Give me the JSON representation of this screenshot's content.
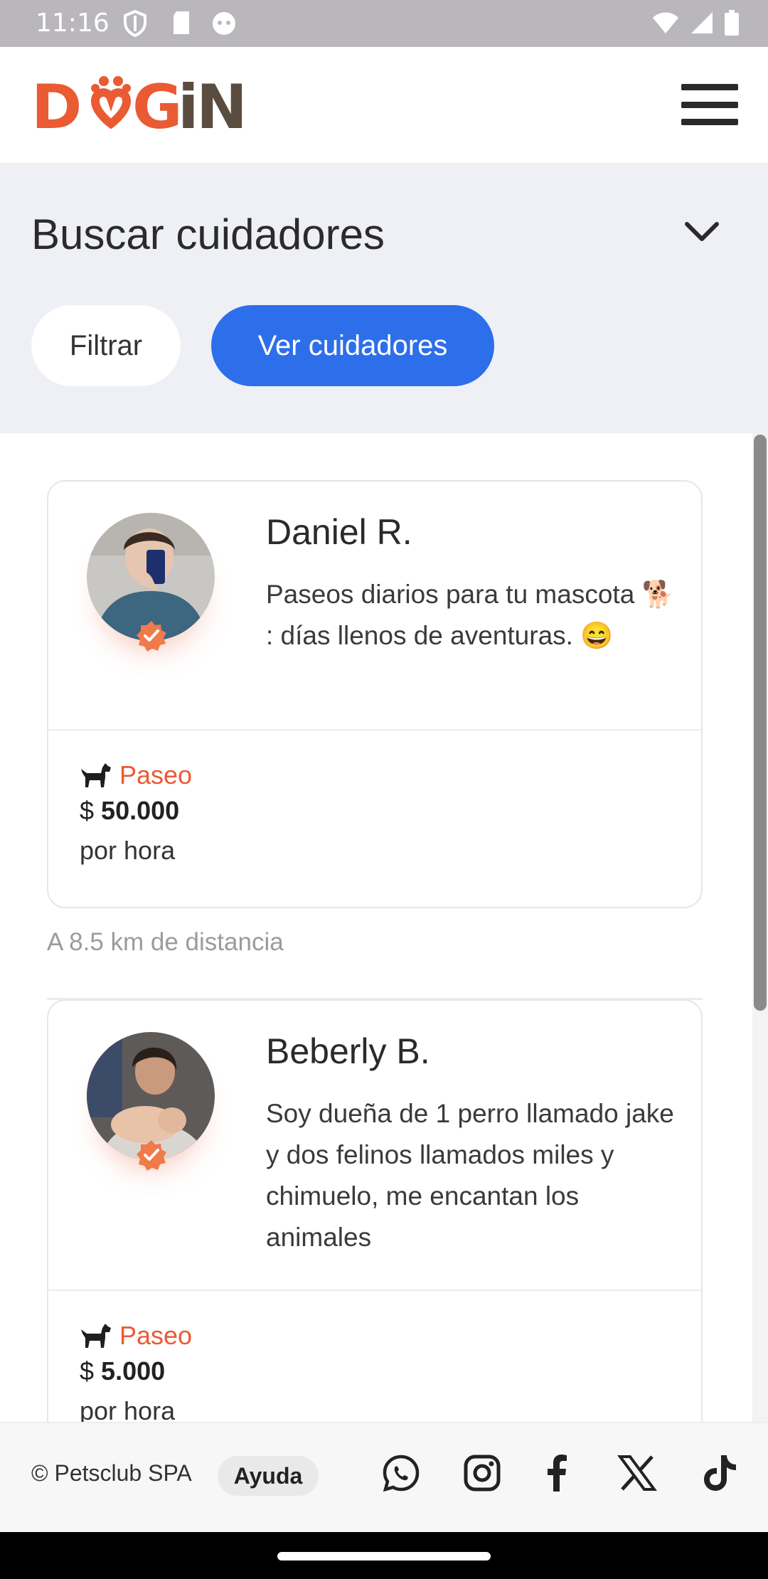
{
  "status_bar": {
    "time": "11:16"
  },
  "header": {
    "logo_text": "DOGiN"
  },
  "search": {
    "title": "Buscar cuidadores",
    "filter_label": "Filtrar",
    "view_label": "Ver cuidadores"
  },
  "caregivers": [
    {
      "name": "Daniel R.",
      "description": "Paseos diarios para tu mascota 🐕 : días llenos de aventuras. 😄",
      "service": "Paseo",
      "currency": "$",
      "price": "50.000",
      "unit": "por hora",
      "distance": "A 8.5 km de distancia"
    },
    {
      "name": "Beberly B.",
      "description": "Soy dueña de 1 perro llamado jake y dos felinos llamados miles y chimuelo, me encantan los animales",
      "service": "Paseo",
      "currency": "$",
      "price": "5.000",
      "unit": "por hora"
    }
  ],
  "footer": {
    "copyright": "© Petsclub SPA",
    "help_label": "Ayuda",
    "social_icons": [
      "whatsapp-icon",
      "instagram-icon",
      "facebook-icon",
      "x-icon",
      "tiktok-icon"
    ]
  },
  "colors": {
    "accent": "#ea5a33",
    "primary": "#2d6eeb",
    "brown": "#5b4c40"
  }
}
